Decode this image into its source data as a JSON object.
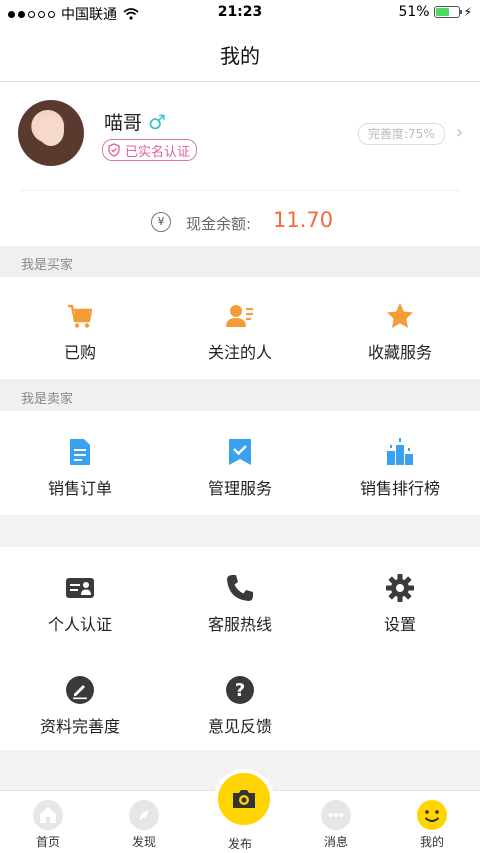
{
  "status_bar": {
    "carrier": "中国联通",
    "time": "21:23",
    "battery": "51%"
  },
  "nav": {
    "title": "我的"
  },
  "profile": {
    "name": "喵哥",
    "gender_symbol": "♂",
    "verified_label": "已实名认证",
    "completion_label": "完善度:75%",
    "balance_label": "现金余额:",
    "balance_value": "11.70",
    "currency_symbol": "¥"
  },
  "buyer": {
    "header": "我是买家",
    "items": [
      {
        "label": "已购",
        "icon": "cart-icon"
      },
      {
        "label": "关注的人",
        "icon": "person-follow-icon"
      },
      {
        "label": "收藏服务",
        "icon": "star-icon"
      }
    ]
  },
  "seller": {
    "header": "我是卖家",
    "items": [
      {
        "label": "销售订单",
        "icon": "document-icon"
      },
      {
        "label": "管理服务",
        "icon": "bookmark-check-icon"
      },
      {
        "label": "销售排行榜",
        "icon": "ranking-icon"
      }
    ]
  },
  "misc": {
    "items": [
      {
        "label": "个人认证",
        "icon": "id-card-icon"
      },
      {
        "label": "客服热线",
        "icon": "phone-icon"
      },
      {
        "label": "设置",
        "icon": "gear-icon"
      },
      {
        "label": "资料完善度",
        "icon": "edit-icon"
      },
      {
        "label": "意见反馈",
        "icon": "question-icon"
      }
    ]
  },
  "tabbar": {
    "items": [
      {
        "label": "首页",
        "icon": "home-icon"
      },
      {
        "label": "发现",
        "icon": "compass-icon"
      },
      {
        "label": "发布",
        "icon": "camera-icon"
      },
      {
        "label": "消息",
        "icon": "message-icon"
      },
      {
        "label": "我的",
        "icon": "smiley-icon"
      }
    ]
  },
  "colors": {
    "accent": "#ffd400",
    "balance": "#f36b3b",
    "orange_icon": "#f59c36",
    "blue_icon": "#3aa0f0",
    "dark_icon": "#3a3a3a"
  }
}
